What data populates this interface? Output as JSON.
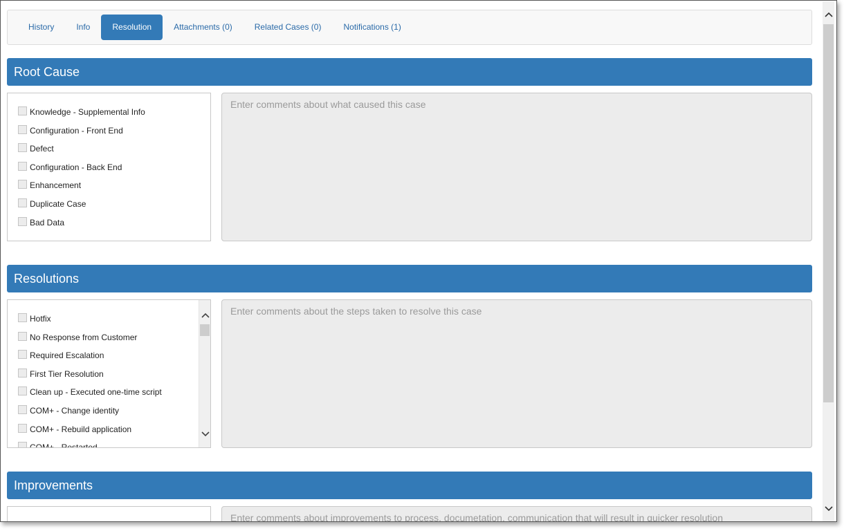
{
  "tabs": [
    {
      "label": "History"
    },
    {
      "label": "Info"
    },
    {
      "label": "Resolution",
      "active": true
    },
    {
      "label": "Attachments (0)"
    },
    {
      "label": "Related Cases (0)"
    },
    {
      "label": "Notifications (1)"
    }
  ],
  "root_cause": {
    "title": "Root Cause",
    "options": [
      "Knowledge - Supplemental Info",
      "Configuration - Front End",
      "Defect",
      "Configuration - Back End",
      "Enhancement",
      "Duplicate Case",
      "Bad Data"
    ],
    "comment_placeholder": "Enter comments about what caused this case"
  },
  "resolutions": {
    "title": "Resolutions",
    "options": [
      "Hotfix",
      "No Response from Customer",
      "Required Escalation",
      "First Tier Resolution",
      "Clean up - Executed one-time script",
      "COM+ - Change identity",
      "COM+ - Rebuild application",
      "COM+ - Restarted"
    ],
    "comment_placeholder": "Enter comments about the steps taken to resolve this case"
  },
  "improvements": {
    "title": "Improvements",
    "comment_placeholder": "Enter comments about improvements to process, documetation, communication that will result in quicker resolution"
  },
  "icons": {
    "scroll_up": "chevron-up-icon",
    "scroll_down": "chevron-down-icon"
  },
  "colors": {
    "accent": "#337ab7",
    "tab_text": "#2a6aa8",
    "textarea_bg": "#ececec"
  }
}
